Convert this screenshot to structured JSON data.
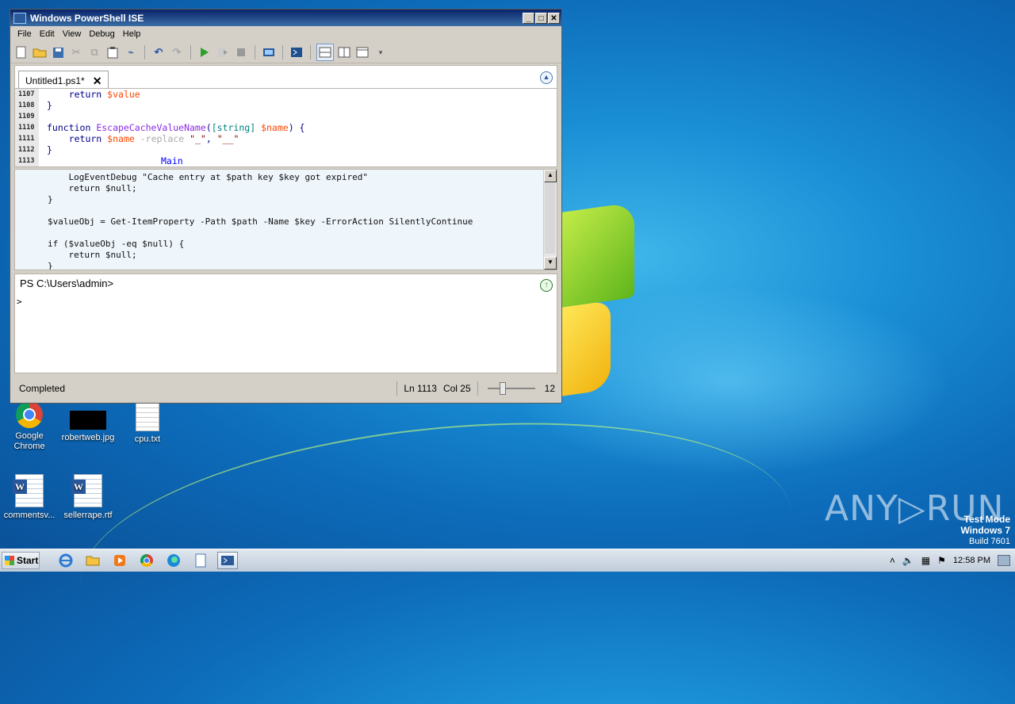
{
  "window": {
    "title": "Windows PowerShell ISE",
    "controls": {
      "minimize": "_",
      "maximize": "□",
      "close": "✕"
    }
  },
  "menu": [
    "File",
    "Edit",
    "View",
    "Debug",
    "Help"
  ],
  "toolbar": {
    "icons": [
      "new-file-icon",
      "open-folder-icon",
      "save-icon",
      "cut-icon",
      "copy-icon",
      "paste-icon",
      "clear-icon",
      "undo-icon",
      "redo-icon",
      "run-icon",
      "run-selection-icon",
      "stop-icon",
      "new-remote-tab-icon",
      "launch-console-icon",
      "layout-top-icon",
      "layout-right-icon",
      "layout-maximized-icon",
      "toolbar-options-icon"
    ]
  },
  "tab": {
    "label": "Untitled1.ps1*",
    "close": "✕"
  },
  "editor": {
    "lines": [
      {
        "num": "1107",
        "code": "    return $value"
      },
      {
        "num": "1108",
        "code": "}"
      },
      {
        "num": "1109",
        "code": ""
      },
      {
        "num": "1110",
        "code": "function EscapeCacheValueName([string] $name) {"
      },
      {
        "num": "1111",
        "code": "    return $name -replace \"_\", \"__\""
      },
      {
        "num": "1112",
        "code": "}"
      },
      {
        "num": "1113",
        "code": "Main"
      }
    ]
  },
  "debug_pane": {
    "lines": [
      "    LogEventDebug \"Cache entry at $path key $key got expired\"",
      "    return $null;",
      "}",
      "",
      "$valueObj = Get-ItemProperty -Path $path -Name $key -ErrorAction SilentlyContinue",
      "",
      "if ($valueObj -eq $null) {",
      "    return $null;",
      "}"
    ]
  },
  "console": {
    "prompt": "PS C:\\Users\\admin>",
    "caret": ">"
  },
  "status": {
    "text": "Completed",
    "ln": "Ln 1113",
    "col": "Col 25",
    "zoom": "12"
  },
  "desktop_icons": [
    {
      "label": "Google\nChrome"
    },
    {
      "label": "robertweb.jpg"
    },
    {
      "label": "cpu.txt"
    },
    {
      "label": "commentsv..."
    },
    {
      "label": "sellerrape.rtf"
    }
  ],
  "watermark": {
    "brand": "ANY▷RUN",
    "test_mode": "Test Mode",
    "os": "Windows 7",
    "build": "Build 7601"
  },
  "taskbar": {
    "start": "Start",
    "clock": "12:58 PM"
  }
}
